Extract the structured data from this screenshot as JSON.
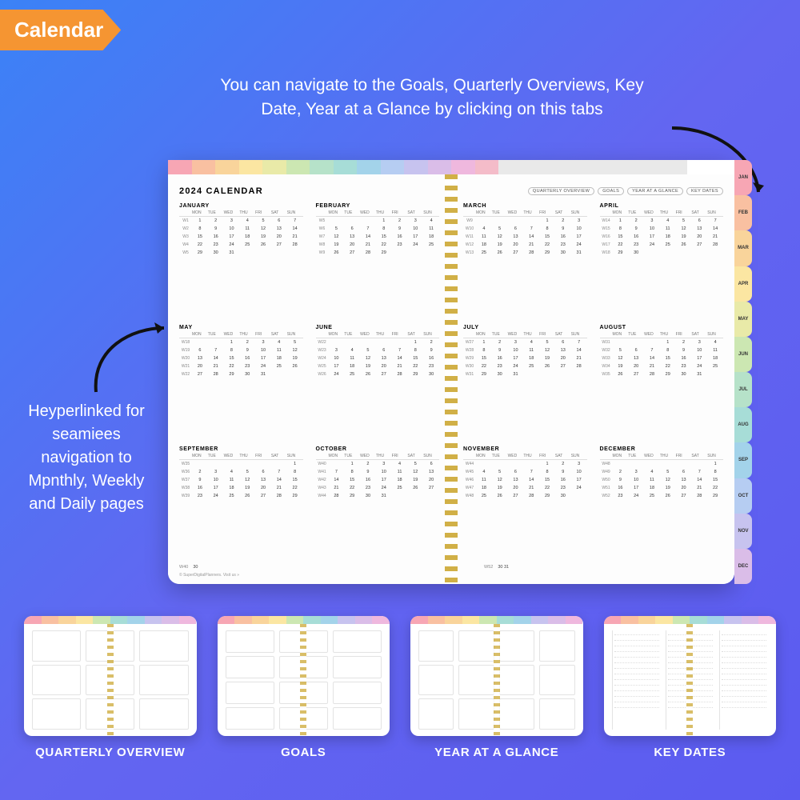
{
  "badge": "Calendar",
  "instruction": "You can navigate to the Goals, Quarterly Overviews, Key Date, Year at a Glance by clicking on this tabs",
  "side_note": "Heyperlinked for seamiees navigation to Mpnthly, Weekly and Daily pages",
  "planner": {
    "title": "2024 CALENDAR",
    "nav_buttons": [
      "QUARTERLY OVERVIEW",
      "GOALS",
      "YEAR AT A GLANCE",
      "KEY DATES"
    ],
    "dow": [
      "MON",
      "TUE",
      "WED",
      "THU",
      "FRI",
      "SAT",
      "SUN"
    ],
    "footer": "© SuperDigitalPlanners.   Visit us »",
    "top_tab_colors": [
      "#f7a6b4",
      "#f9c0a1",
      "#f9d49b",
      "#fbe6a2",
      "#e9eaa8",
      "#cce7b2",
      "#b6e2c9",
      "#a7ddd7",
      "#a3d3ea",
      "#b6cdf2",
      "#c7c3ef",
      "#dabde8",
      "#efb8de",
      "#f4bcc9",
      "#e9e9e9",
      "#e9e9e9",
      "#e9e9e9",
      "#e9e9e9",
      "#e9e9e9",
      "#e9e9e9",
      "#e9e9e9",
      "#e9e9e9",
      "#ffffff",
      "#ffffff"
    ],
    "side_tabs": [
      {
        "label": "JAN",
        "color": "#f7a6b4"
      },
      {
        "label": "FEB",
        "color": "#f9c0a1"
      },
      {
        "label": "MAR",
        "color": "#f9d49b"
      },
      {
        "label": "APR",
        "color": "#fbe6a2"
      },
      {
        "label": "MAY",
        "color": "#e9eaa8"
      },
      {
        "label": "JUN",
        "color": "#cce7b2"
      },
      {
        "label": "JUL",
        "color": "#b6e2c9"
      },
      {
        "label": "AUG",
        "color": "#a7ddd7"
      },
      {
        "label": "SEP",
        "color": "#a3d3ea"
      },
      {
        "label": "OCT",
        "color": "#b6cdf2"
      },
      {
        "label": "NOV",
        "color": "#c7c3ef"
      },
      {
        "label": "DEC",
        "color": "#dabde8"
      }
    ],
    "months": [
      {
        "name": "JANUARY",
        "start": 1,
        "ndays": 31,
        "wk": 1
      },
      {
        "name": "FEBRUARY",
        "start": 4,
        "ndays": 29,
        "wk": 5
      },
      {
        "name": "MARCH",
        "start": 5,
        "ndays": 31,
        "wk": 9
      },
      {
        "name": "APRIL",
        "start": 1,
        "ndays": 30,
        "wk": 14
      },
      {
        "name": "MAY",
        "start": 3,
        "ndays": 31,
        "wk": 18
      },
      {
        "name": "JUNE",
        "start": 6,
        "ndays": 30,
        "wk": 22
      },
      {
        "name": "JULY",
        "start": 1,
        "ndays": 31,
        "wk": 27
      },
      {
        "name": "AUGUST",
        "start": 4,
        "ndays": 31,
        "wk": 31
      },
      {
        "name": "SEPTEMBER",
        "start": 7,
        "ndays": 30,
        "wk": 35
      },
      {
        "name": "OCTOBER",
        "start": 2,
        "ndays": 31,
        "wk": 40
      },
      {
        "name": "NOVEMBER",
        "start": 5,
        "ndays": 30,
        "wk": 44
      },
      {
        "name": "DECEMBER",
        "start": 7,
        "ndays": 31,
        "wk": 48
      }
    ],
    "extra": [
      {
        "wk": "W40",
        "day": "30"
      },
      {
        "wk": "W52",
        "day": "30  31"
      }
    ]
  },
  "thumbs": [
    {
      "label": "QUARTERLY OVERVIEW",
      "grid": "g3x3"
    },
    {
      "label": "GOALS",
      "grid": "g3x4"
    },
    {
      "label": "YEAR AT A GLANCE",
      "grid": "g4"
    },
    {
      "label": "KEY DATES",
      "grid": "lines"
    }
  ]
}
